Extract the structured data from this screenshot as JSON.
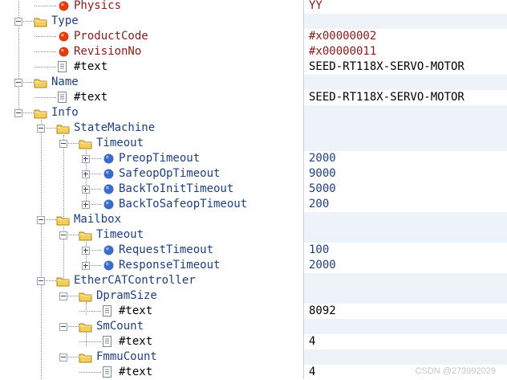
{
  "colors": {
    "attribute": "#8b1a1a",
    "element": "#1f3f7f",
    "text_node": "#000000",
    "value_attribute": "#8b1a1a",
    "value_element": "#1f3f7f",
    "value_text": "#000000",
    "attr_icon": "#e03e10",
    "elem_icon": "#3b6bc9",
    "folder_icon": "#f3cf5a"
  },
  "rows": [
    {
      "label": "Physics",
      "kind": "attr",
      "icon": "attribute-dot-icon",
      "value": "YY"
    },
    {
      "label": "Type",
      "kind": "folder",
      "icon": "folder-icon",
      "value": ""
    },
    {
      "label": "ProductCode",
      "kind": "attr",
      "icon": "attribute-dot-icon",
      "value": "#x00000002"
    },
    {
      "label": "RevisionNo",
      "kind": "attr",
      "icon": "attribute-dot-icon",
      "value": "#x00000011"
    },
    {
      "label": "#text",
      "kind": "text",
      "icon": "text-document-icon",
      "value": "SEED-RT118X-SERVO-MOTOR"
    },
    {
      "label": "Name",
      "kind": "folder",
      "icon": "folder-icon",
      "value": ""
    },
    {
      "label": "#text",
      "kind": "text",
      "icon": "text-document-icon",
      "value": "SEED-RT118X-SERVO-MOTOR"
    },
    {
      "label": "Info",
      "kind": "folder",
      "icon": "folder-icon",
      "value": ""
    },
    {
      "label": "StateMachine",
      "kind": "folder",
      "icon": "folder-icon",
      "value": ""
    },
    {
      "label": "Timeout",
      "kind": "folder",
      "icon": "folder-icon",
      "value": ""
    },
    {
      "label": "PreopTimeout",
      "kind": "elem",
      "icon": "element-dot-icon",
      "value": "2000"
    },
    {
      "label": "SafeopOpTimeout",
      "kind": "elem",
      "icon": "element-dot-icon",
      "value": "9000"
    },
    {
      "label": "BackToInitTimeout",
      "kind": "elem",
      "icon": "element-dot-icon",
      "value": "5000"
    },
    {
      "label": "BackToSafeopTimeout",
      "kind": "elem",
      "icon": "element-dot-icon",
      "value": "200"
    },
    {
      "label": "Mailbox",
      "kind": "folder",
      "icon": "folder-icon",
      "value": ""
    },
    {
      "label": "Timeout",
      "kind": "folder",
      "icon": "folder-icon",
      "value": ""
    },
    {
      "label": "RequestTimeout",
      "kind": "elem",
      "icon": "element-dot-icon",
      "value": "100"
    },
    {
      "label": "ResponseTimeout",
      "kind": "elem",
      "icon": "element-dot-icon",
      "value": "2000"
    },
    {
      "label": "EtherCATController",
      "kind": "folder",
      "icon": "folder-icon",
      "value": ""
    },
    {
      "label": "DpramSize",
      "kind": "folder",
      "icon": "folder-icon",
      "value": ""
    },
    {
      "label": "#text",
      "kind": "text",
      "icon": "text-document-icon",
      "value": "8092"
    },
    {
      "label": "SmCount",
      "kind": "folder",
      "icon": "folder-icon",
      "value": ""
    },
    {
      "label": "#text",
      "kind": "text",
      "icon": "text-document-icon",
      "value": "4"
    },
    {
      "label": "FmmuCount",
      "kind": "folder",
      "icon": "folder-icon",
      "value": ""
    },
    {
      "label": "#text",
      "kind": "text",
      "icon": "text-document-icon",
      "value": "4"
    }
  ],
  "watermark": "CSDN @273992029"
}
